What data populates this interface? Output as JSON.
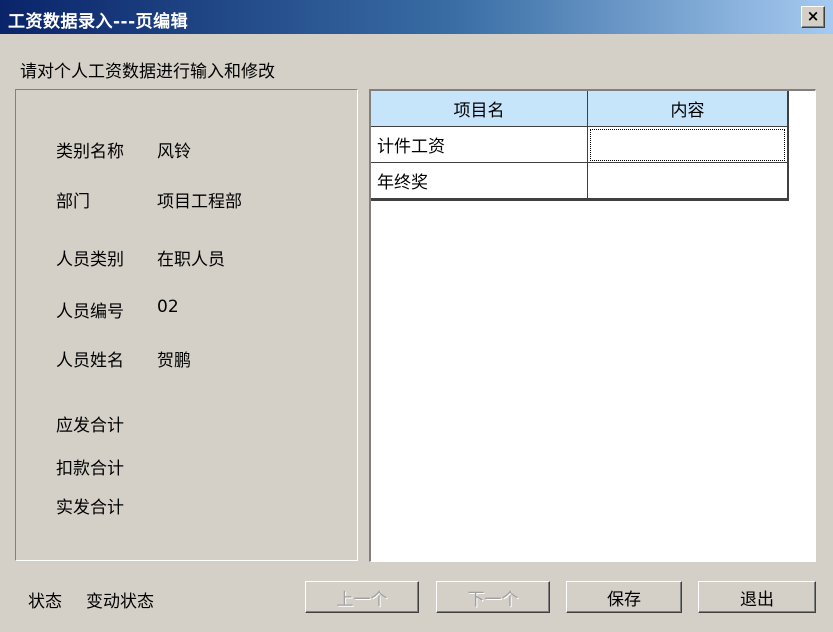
{
  "window": {
    "title": "工资数据录入---页编辑",
    "close_glyph": "×"
  },
  "instruction": "请对个人工资数据进行输入和修改",
  "info": {
    "category_label": "类别名称",
    "category_value": "风铃",
    "department_label": "部门",
    "department_value": "项目工程部",
    "staff_type_label": "人员类别",
    "staff_type_value": "在职人员",
    "staff_no_label": "人员编号",
    "staff_no_value": "02",
    "staff_name_label": "人员姓名",
    "staff_name_value": "贺鹏",
    "payable_total_label": "应发合计",
    "deduction_total_label": "扣款合计",
    "actual_total_label": "实发合计"
  },
  "grid": {
    "headers": [
      "项目名",
      "内容"
    ],
    "rows": [
      {
        "item": "计件工资",
        "content": ""
      },
      {
        "item": "年终奖",
        "content": ""
      }
    ]
  },
  "status": {
    "label": "状态",
    "value": "变动状态"
  },
  "buttons": {
    "prev": "上一个",
    "next": "下一个",
    "save": "保存",
    "exit": "退出"
  },
  "colors": {
    "title_bar": "#0a246a",
    "header_bg": "#c6e4fa",
    "window_bg": "#d4d0c8"
  }
}
